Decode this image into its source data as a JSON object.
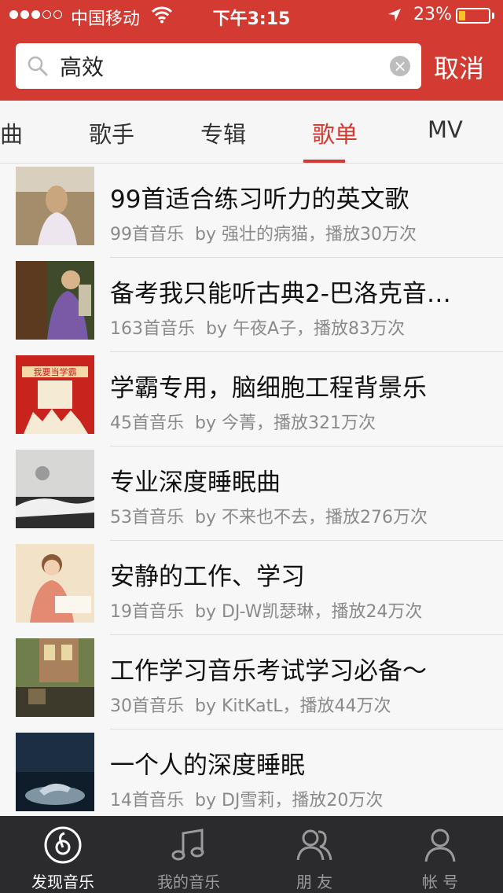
{
  "status_bar": {
    "carrier": "中国移动",
    "time": "下午3:15",
    "battery": "23%",
    "battery_level": 0.23,
    "icons": [
      "signal-dots",
      "wifi-icon",
      "location-arrow-icon",
      "battery-icon"
    ]
  },
  "search": {
    "query": "高效",
    "cancel_label": "取消",
    "icons": [
      "search-icon",
      "clear-icon"
    ]
  },
  "tabs": [
    {
      "label": "曲"
    },
    {
      "label": "歌手"
    },
    {
      "label": "专辑"
    },
    {
      "label": "歌单",
      "active": true
    },
    {
      "label": "MV"
    }
  ],
  "results": [
    {
      "title": "99首适合练习听力的英文歌",
      "count": "99首音乐",
      "author": "by 强壮的病猫",
      "plays": "，播放30万次"
    },
    {
      "title": "备考我只能听古典2-巴洛克音…",
      "count": "163首音乐",
      "author": "by 午夜A子",
      "plays": "，播放83万次"
    },
    {
      "title": "学霸专用，脑细胞工程背景乐",
      "count": "45首音乐",
      "author": "by 今菁",
      "plays": "，播放321万次",
      "thumb_text": "我要当学霸"
    },
    {
      "title": "专业深度睡眠曲",
      "count": "53首音乐",
      "author": "by 不来也不去",
      "plays": "，播放276万次"
    },
    {
      "title": "安静的工作、学习",
      "count": "19首音乐",
      "author": "by DJ-W凯瑟琳",
      "plays": "，播放24万次"
    },
    {
      "title": "工作学习音乐考试学习必备～",
      "count": "30首音乐",
      "author": "by KitKatL",
      "plays": "，播放44万次"
    },
    {
      "title": "一个人的深度睡眠",
      "count": "14首音乐",
      "author": "by DJ雪莉",
      "plays": "，播放20万次"
    }
  ],
  "tabbar": [
    {
      "label": "发现音乐",
      "icon": "netease-logo-icon",
      "active": true
    },
    {
      "label": "我的音乐",
      "icon": "music-note-icon"
    },
    {
      "label": "朋 友",
      "icon": "friends-icon"
    },
    {
      "label": "帐 号",
      "icon": "account-icon"
    }
  ],
  "colors": {
    "accent": "#d33a31",
    "tabbar_bg": "#2b2b2d"
  }
}
